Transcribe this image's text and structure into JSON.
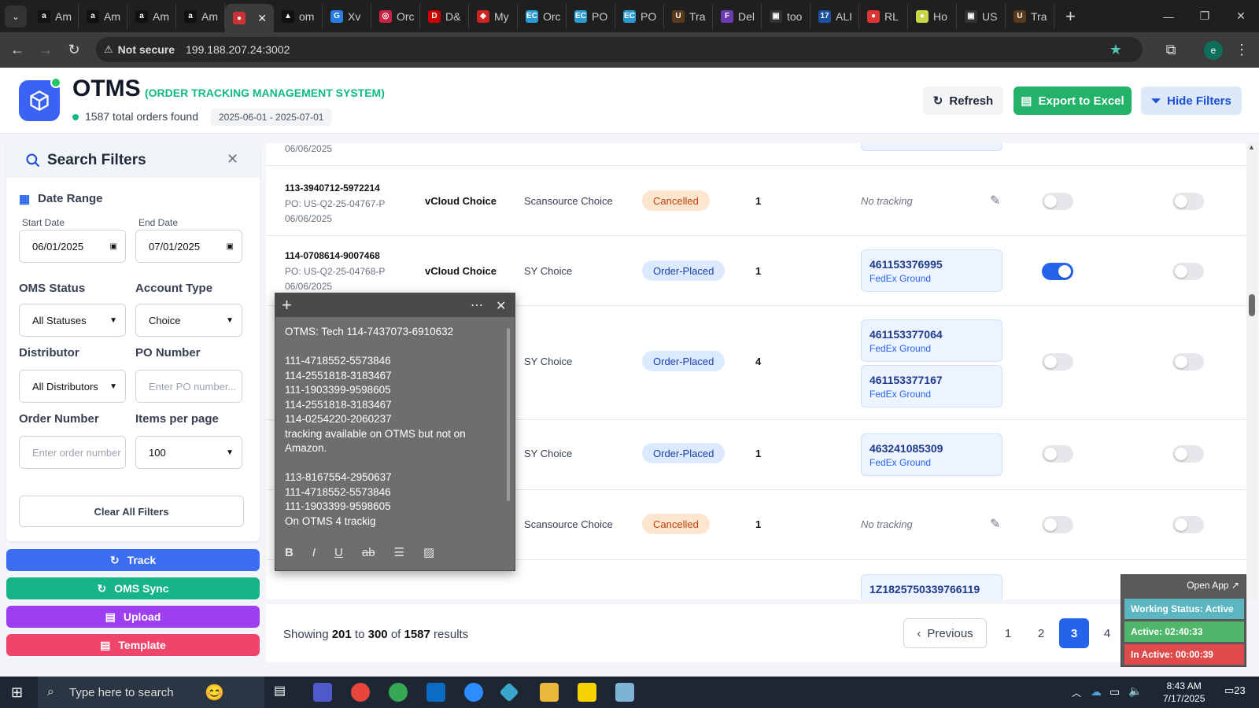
{
  "browser": {
    "tabs": [
      {
        "label": "Am",
        "color": "#111",
        "glyph": "a"
      },
      {
        "label": "Am",
        "color": "#111",
        "glyph": "a"
      },
      {
        "label": "Am",
        "color": "#111",
        "glyph": "a"
      },
      {
        "label": "Am",
        "color": "#111",
        "glyph": "a"
      },
      {
        "label": "",
        "color": "#c33",
        "glyph": "●",
        "active": true
      },
      {
        "label": "om",
        "color": "#111",
        "glyph": "▲"
      },
      {
        "label": "Xv",
        "color": "#2a7de1",
        "glyph": "G"
      },
      {
        "label": "Orc",
        "color": "#c24",
        "glyph": "◎"
      },
      {
        "label": "D&",
        "color": "#c00",
        "glyph": "D"
      },
      {
        "label": "My",
        "color": "#c22",
        "glyph": "◈"
      },
      {
        "label": "Orc",
        "color": "#2a9ad0",
        "glyph": "EC"
      },
      {
        "label": "PO",
        "color": "#2a9ad0",
        "glyph": "EC"
      },
      {
        "label": "PO",
        "color": "#2a9ad0",
        "glyph": "EC"
      },
      {
        "label": "Tra",
        "color": "#5a3a1a",
        "glyph": "U"
      },
      {
        "label": "Del",
        "color": "#6a3ab0",
        "glyph": "F"
      },
      {
        "label": "too",
        "color": "#333",
        "glyph": "▣"
      },
      {
        "label": "ALI",
        "color": "#1b4fa0",
        "glyph": "17"
      },
      {
        "label": "RL",
        "color": "#d33",
        "glyph": "●"
      },
      {
        "label": "Ho",
        "color": "#c7d54a",
        "glyph": "●"
      },
      {
        "label": "US",
        "color": "#333",
        "glyph": "▣"
      },
      {
        "label": "Tra",
        "color": "#5a3a1a",
        "glyph": "U"
      }
    ],
    "not_secure": "Not secure",
    "url": "199.188.207.24:3002",
    "profile_initial": "e"
  },
  "header": {
    "brand": "OTMS",
    "brand_sub": "(ORDER TRACKING MANAGEMENT SYSTEM)",
    "total_orders": "1587 total orders found",
    "date_range": "2025-06-01 - 2025-07-01",
    "refresh_label": "Refresh",
    "export_label": "Export to Excel",
    "hide_filters_label": "Hide Filters"
  },
  "filters": {
    "title": "Search Filters",
    "date_range_label": "Date Range",
    "start_label": "Start Date",
    "start_value": "06/01/2025",
    "end_label": "End Date",
    "end_value": "07/01/2025",
    "oms_status_label": "OMS Status",
    "oms_status_value": "All Statuses",
    "account_type_label": "Account Type",
    "account_type_value": "Choice",
    "distributor_label": "Distributor",
    "distributor_value": "All Distributors",
    "po_label": "PO Number",
    "po_placeholder": "Enter PO number...",
    "order_label": "Order Number",
    "order_placeholder": "Enter order number",
    "per_page_label": "Items per page",
    "per_page_value": "100",
    "clear_label": "Clear All Filters"
  },
  "actions": {
    "track": "Track",
    "oms_sync": "OMS Sync",
    "upload": "Upload",
    "template": "Template"
  },
  "rows": [
    {
      "date": "06/06/2025"
    },
    {
      "order": "113-3940712-5972214",
      "po": "PO: US-Q2-25-04767-P",
      "date": "06/06/2025",
      "account": "vCloud Choice",
      "distributor": "Scansource Choice",
      "status": "Cancelled",
      "qty": "1",
      "tracking": "No tracking"
    },
    {
      "order": "114-0708614-9007468",
      "po": "PO: US-Q2-25-04768-P",
      "date": "06/06/2025",
      "account": "vCloud Choice",
      "distributor": "SY Choice",
      "status": "Order-Placed",
      "qty": "1",
      "track1": "461153376995",
      "carrier1": "FedEx Ground"
    },
    {
      "distributor": "SY Choice",
      "status": "Order-Placed",
      "qty": "4",
      "track1": "461153377064",
      "carrier1": "FedEx Ground",
      "track2": "461153377167",
      "carrier2": "FedEx Ground"
    },
    {
      "distributor": "SY Choice",
      "status": "Order-Placed",
      "qty": "1",
      "track1": "463241085309",
      "carrier1": "FedEx Ground"
    },
    {
      "distributor": "Scansource Choice",
      "status": "Cancelled",
      "qty": "1",
      "tracking": "No tracking"
    },
    {
      "track1": "1Z1825750339766119"
    }
  ],
  "pagination": {
    "showing": "Showing",
    "from": "201",
    "to_word": "to",
    "to": "300",
    "of_word": "of",
    "total": "1587",
    "results": "results",
    "previous": "Previous",
    "pages": [
      "1",
      "2",
      "3",
      "4"
    ],
    "current": "3"
  },
  "sticky_note": {
    "text": "OTMS: Tech 114-7437073-6910632\n\n111-4718552-5573846\n114-2551818-3183467\n111-1903399-9598605\n114-2551818-3183467\n114-0254220-2060237\ntracking available on OTMS but not on Amazon.\n\n113-8167554-2950637\n111-4718552-5573846\n111-1903399-9598605\nOn OTMS 4 trackig"
  },
  "widget": {
    "open_app": "Open App ↗",
    "working": "Working Status: Active",
    "active": "Active: 02:40:33",
    "inactive": "In Active: 00:00:39"
  },
  "taskbar": {
    "search_placeholder": "Type here to search",
    "time": "8:43 AM",
    "date": "7/17/2025",
    "notif_count": "23"
  }
}
